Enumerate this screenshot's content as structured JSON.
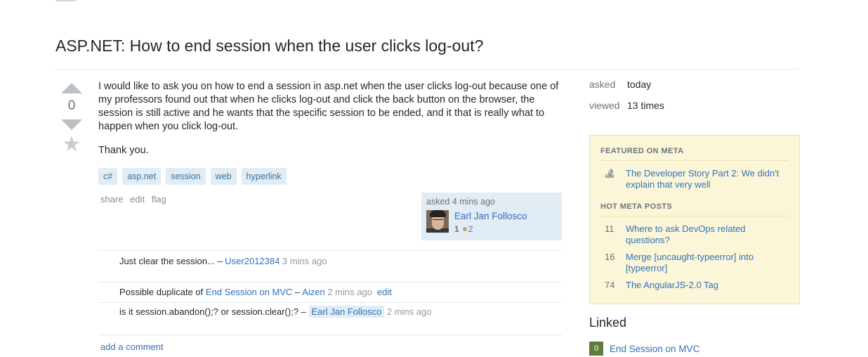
{
  "question": {
    "title": "ASP.NET: How to end session when the user clicks log-out?",
    "vote_count": "0",
    "body": [
      "I would like to ask you on how to end a session in asp.net when the user clicks log-out because one of my professors found out that when he clicks log-out and click the back button on the browser, the session is still active and he wants that the specific session to be ended, and it that is really what to happen when you click log-out.",
      "Thank you."
    ],
    "tags": [
      "c#",
      "asp.net",
      "session",
      "web",
      "hyperlink"
    ],
    "menu": [
      "share",
      "edit",
      "flag"
    ]
  },
  "owner": {
    "asked_time": "asked 4 mins ago",
    "name": "Earl Jan Follosco",
    "reputation": "1",
    "bronze_badges": "2"
  },
  "comments": [
    {
      "prefix": "Just clear the session... – ",
      "link": "",
      "dash": "",
      "user": "User2012384",
      "date": " 3 mins ago",
      "edit": ""
    },
    {
      "prefix": "Possible duplicate of ",
      "link": "End Session on MVC",
      "dash": " – ",
      "user": "Aizen",
      "date": " 2 mins ago",
      "edit": "edit"
    },
    {
      "prefix": "is it session.abandon();? or session.clear();? – ",
      "link": "",
      "dash": "",
      "user": "Earl Jan Follosco",
      "date": " 2 mins ago",
      "edit": ""
    }
  ],
  "add_comment_label": "add a comment",
  "stats": {
    "asked_label": "asked",
    "asked_value": "today",
    "viewed_label": "viewed",
    "viewed_value": "13 times"
  },
  "meta": {
    "featured_heading": "FEATURED ON META",
    "featured_item": "The Developer Story Part 2: We didn't explain that very well",
    "featured_icon": "stack-icon",
    "hot_heading": "HOT META POSTS",
    "hot_posts": [
      {
        "count": "11",
        "title": "Where to ask DevOps related questions?"
      },
      {
        "count": "16",
        "title": "Merge [uncaught-typeerror] into [typeerror]"
      },
      {
        "count": "74",
        "title": "The AngularJS-2.0 Tag"
      }
    ]
  },
  "linked": {
    "title": "Linked",
    "items": [
      {
        "count": "0",
        "title": "End Session on MVC"
      }
    ]
  },
  "colors": {
    "link": "#3171b7",
    "tag_bg": "#e1ecf4",
    "tag_text": "#39739d",
    "meta_bg": "#fcf6d8",
    "linked_count_bg": "#5e7e3b"
  }
}
